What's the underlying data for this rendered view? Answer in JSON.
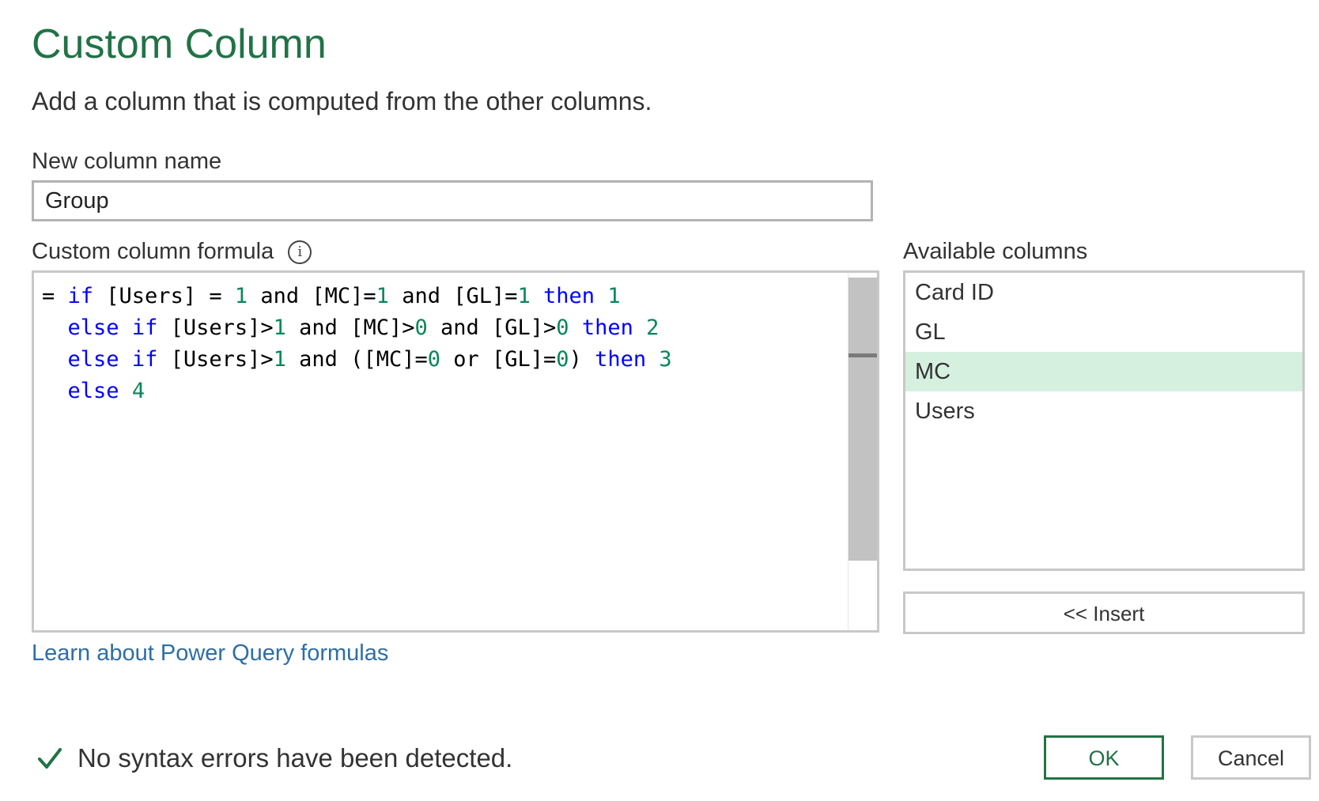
{
  "dialog": {
    "title": "Custom Column",
    "subtitle": "Add a column that is computed from the other columns."
  },
  "new_column": {
    "label": "New column name",
    "value": "Group"
  },
  "formula": {
    "label": "Custom column formula",
    "info_icon": "info-icon",
    "lines": [
      [
        {
          "t": "= ",
          "c": "txt"
        },
        {
          "t": "if",
          "c": "kw"
        },
        {
          "t": " [Users] = ",
          "c": "txt"
        },
        {
          "t": "1",
          "c": "num"
        },
        {
          "t": " and [MC]=",
          "c": "txt"
        },
        {
          "t": "1",
          "c": "num"
        },
        {
          "t": " and [GL]=",
          "c": "txt"
        },
        {
          "t": "1",
          "c": "num"
        },
        {
          "t": " ",
          "c": "txt"
        },
        {
          "t": "then",
          "c": "kw"
        },
        {
          "t": " ",
          "c": "txt"
        },
        {
          "t": "1",
          "c": "num"
        }
      ],
      [
        {
          "t": "  ",
          "c": "txt"
        },
        {
          "t": "else",
          "c": "kw"
        },
        {
          "t": " ",
          "c": "txt"
        },
        {
          "t": "if",
          "c": "kw"
        },
        {
          "t": " [Users]>",
          "c": "txt"
        },
        {
          "t": "1",
          "c": "num"
        },
        {
          "t": " and [MC]>",
          "c": "txt"
        },
        {
          "t": "0",
          "c": "num"
        },
        {
          "t": " and [GL]>",
          "c": "txt"
        },
        {
          "t": "0",
          "c": "num"
        },
        {
          "t": " ",
          "c": "txt"
        },
        {
          "t": "then",
          "c": "kw"
        },
        {
          "t": " ",
          "c": "txt"
        },
        {
          "t": "2",
          "c": "num"
        }
      ],
      [
        {
          "t": "  ",
          "c": "txt"
        },
        {
          "t": "else",
          "c": "kw"
        },
        {
          "t": " ",
          "c": "txt"
        },
        {
          "t": "if",
          "c": "kw"
        },
        {
          "t": " [Users]>",
          "c": "txt"
        },
        {
          "t": "1",
          "c": "num"
        },
        {
          "t": " and ([MC]=",
          "c": "txt"
        },
        {
          "t": "0",
          "c": "num"
        },
        {
          "t": " or [GL]=",
          "c": "txt"
        },
        {
          "t": "0",
          "c": "num"
        },
        {
          "t": ") ",
          "c": "txt"
        },
        {
          "t": "then",
          "c": "kw"
        },
        {
          "t": " ",
          "c": "txt"
        },
        {
          "t": "3",
          "c": "num"
        }
      ],
      [
        {
          "t": "  ",
          "c": "txt"
        },
        {
          "t": "else",
          "c": "kw"
        },
        {
          "t": " ",
          "c": "txt"
        },
        {
          "t": "4",
          "c": "num"
        }
      ]
    ]
  },
  "available_columns": {
    "label": "Available columns",
    "items": [
      "Card ID",
      "GL",
      "MC",
      "Users"
    ],
    "selected": "MC",
    "insert_label": "<< Insert"
  },
  "learn_link": "Learn about Power Query formulas",
  "status": {
    "icon": "checkmark-icon",
    "text": "No syntax errors have been detected."
  },
  "buttons": {
    "ok": "OK",
    "cancel": "Cancel"
  },
  "colors": {
    "accent": "#217346",
    "keyword": "#0000ff",
    "number": "#098658",
    "selected_row": "#d6f0e0",
    "link": "#2e6ea6"
  }
}
